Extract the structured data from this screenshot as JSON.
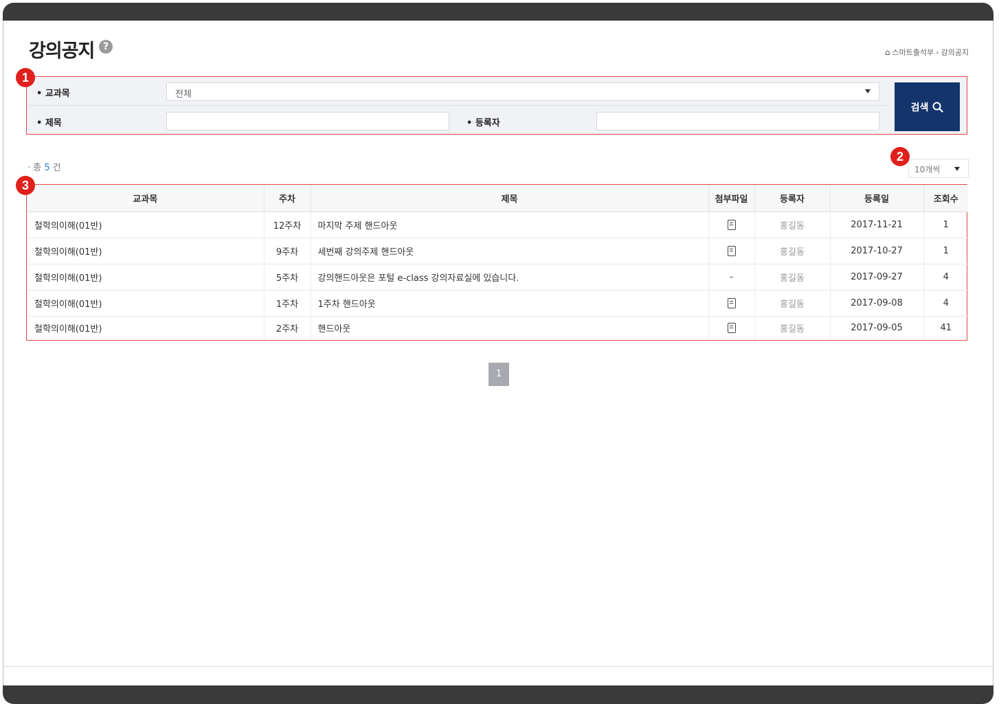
{
  "page": {
    "title": "강의공지",
    "help_icon": "?"
  },
  "breadcrumb": {
    "home_icon": "⌂",
    "items": [
      "스마트출석부",
      "강의공지"
    ],
    "separator": "›"
  },
  "markers": [
    "1",
    "2",
    "3"
  ],
  "search": {
    "course_label": "• 교과목",
    "course_value": "전체",
    "title_label": "• 제목",
    "title_value": "",
    "author_label": "• 등록자",
    "author_value": "",
    "button_label": "검색"
  },
  "summary": {
    "prefix": "· 총",
    "count": "5",
    "suffix": "건"
  },
  "perpage": {
    "value": "10개씩"
  },
  "table": {
    "headers": [
      "교과목",
      "주차",
      "제목",
      "첨부파일",
      "등록자",
      "등록일",
      "조회수"
    ],
    "rows": [
      {
        "course": "철학의이해(01반)",
        "week": "12주차",
        "title": "마지막 주제 핸드아웃",
        "attach": "file-icon",
        "author": "홍길동",
        "date": "2017-11-21",
        "views": "1"
      },
      {
        "course": "철학의이해(01반)",
        "week": "9주차",
        "title": "세번째 강의주제 핸드아웃",
        "attach": "file-icon",
        "author": "홍길동",
        "date": "2017-10-27",
        "views": "1"
      },
      {
        "course": "철학의이해(01반)",
        "week": "5주차",
        "title": "강의핸드아웃은 포털 e-class 강의자료실에 있습니다.",
        "attach": "-",
        "author": "홍길동",
        "date": "2017-09-27",
        "views": "4"
      },
      {
        "course": "철학의이해(01반)",
        "week": "1주차",
        "title": "1주차 핸드아웃",
        "attach": "file-icon",
        "author": "홍길동",
        "date": "2017-09-08",
        "views": "4"
      },
      {
        "course": "철학의이해(01반)",
        "week": "2주차",
        "title": "핸드아웃",
        "attach": "file-icon",
        "author": "홍길동",
        "date": "2017-09-05",
        "views": "41"
      }
    ]
  },
  "pagination": {
    "current": "1"
  },
  "colors": {
    "accent": "#14346b",
    "marker": "#e0201c",
    "link": "#2c7fd9",
    "frame": "#3a3a3a"
  }
}
